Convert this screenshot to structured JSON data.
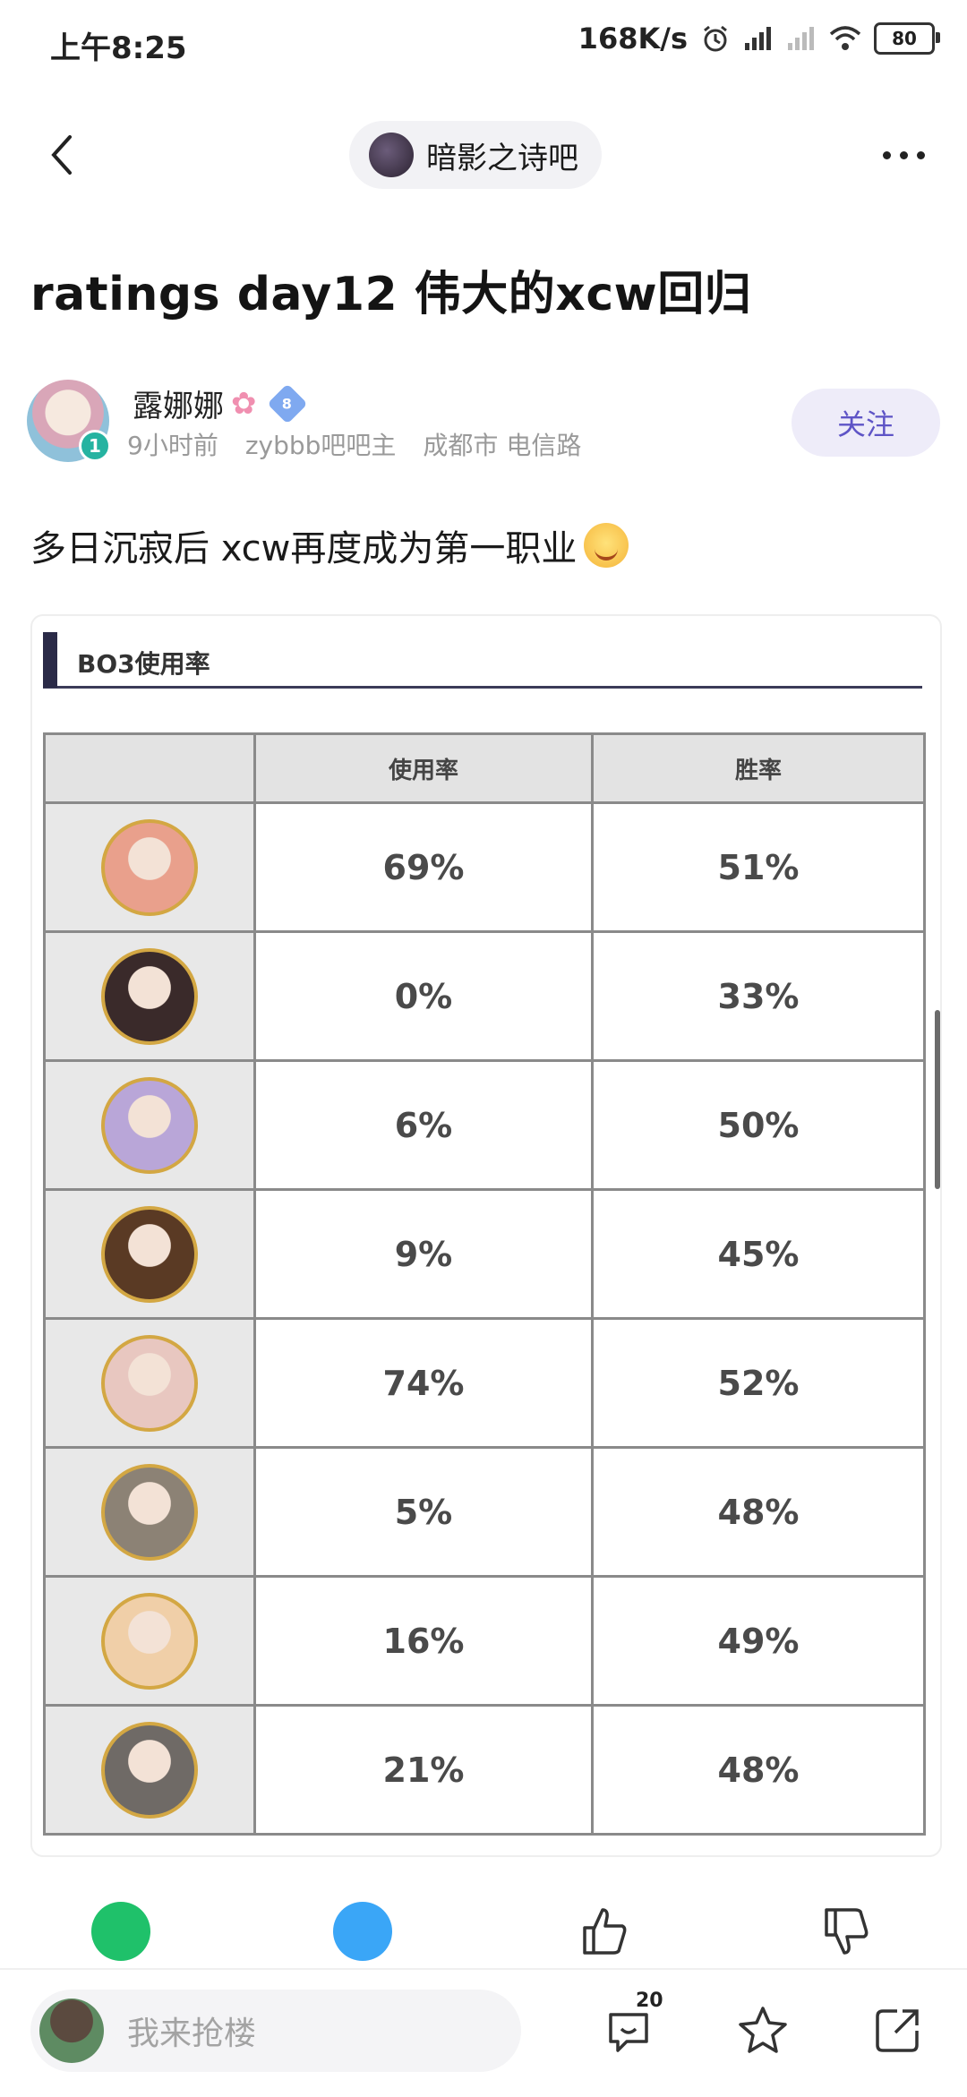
{
  "status_bar": {
    "time": "上午8:25",
    "speed": "168K/s",
    "battery": "80"
  },
  "nav": {
    "forum_name": "暗影之诗吧"
  },
  "post": {
    "title": "ratings day12 伟大的xcw回归",
    "author": {
      "name": "露娜娜",
      "level": "1",
      "badge_level": "8",
      "time_ago": "9小时前",
      "role": "zybbb吧吧主",
      "location": "成都市 电信路"
    },
    "follow_label": "关注",
    "body": "多日沉寂后 xcw再度成为第一职业"
  },
  "image_table": {
    "heading": "BO3使用率",
    "col_usage": "使用率",
    "col_winrate": "胜率",
    "rows": [
      {
        "usage": "69%",
        "winrate": "51%",
        "hero_color": "#e9a08c"
      },
      {
        "usage": "0%",
        "winrate": "33%",
        "hero_color": "#3a2a2a"
      },
      {
        "usage": "6%",
        "winrate": "50%",
        "hero_color": "#b9a6d8"
      },
      {
        "usage": "9%",
        "winrate": "45%",
        "hero_color": "#5a3a24"
      },
      {
        "usage": "74%",
        "winrate": "52%",
        "hero_color": "#e8c7c0"
      },
      {
        "usage": "5%",
        "winrate": "48%",
        "hero_color": "#8c8275"
      },
      {
        "usage": "16%",
        "winrate": "49%",
        "hero_color": "#f0cfa8"
      },
      {
        "usage": "21%",
        "winrate": "48%",
        "hero_color": "#6f6a66"
      }
    ]
  },
  "bottom_bar": {
    "reply_placeholder": "我来抢楼",
    "comment_count": "20"
  }
}
